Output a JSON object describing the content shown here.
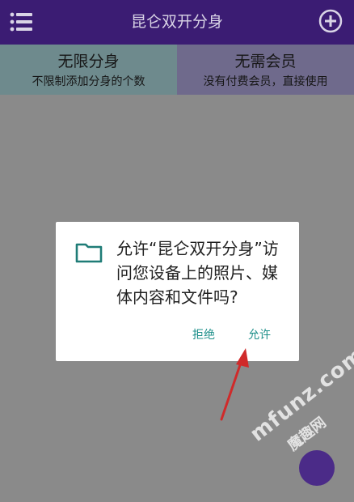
{
  "app": {
    "title": "昆仑双开分身"
  },
  "icons": {
    "menu": "menu-list-icon",
    "add": "add-circle-icon",
    "folder": "folder-icon"
  },
  "banners": [
    {
      "title": "无限分身",
      "subtitle": "不限制添加分身的个数"
    },
    {
      "title": "无需会员",
      "subtitle": "没有付费会员，直接使用"
    }
  ],
  "dialog": {
    "message": "允许“昆仑双开分身”访问您设备上的照片、媒体内容和文件吗?",
    "deny_label": "拒绝",
    "allow_label": "允许"
  },
  "watermark": {
    "text": "mfunz.com",
    "cn": "魔趣网"
  },
  "colors": {
    "topbar": "#3b1c73",
    "accent": "#1d8f8a",
    "arrow": "#d02a2a"
  }
}
